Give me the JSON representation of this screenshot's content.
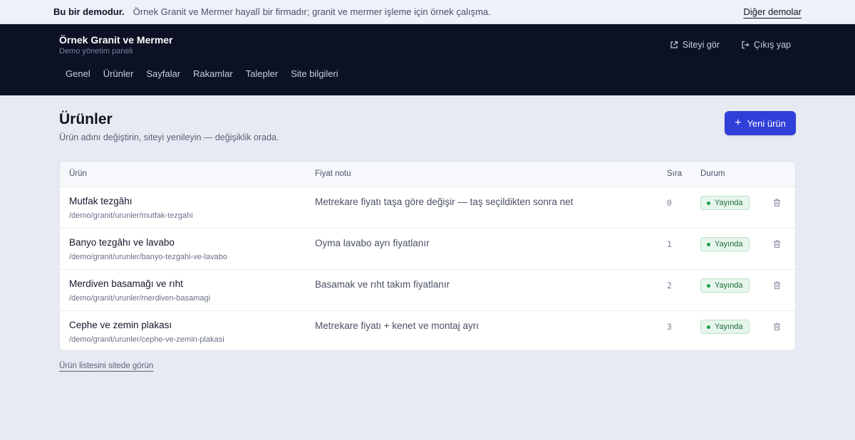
{
  "demo_bar": {
    "strong": "Bu bir demodur.",
    "desc": "Örnek Granit ve Mermer hayalî bir firmadır; granit ve mermer işleme için örnek çalışma.",
    "other_link": "Diğer demolar"
  },
  "header": {
    "brand": "Örnek Granit ve Mermer",
    "subtitle": "Demo yönetim paneli",
    "actions": [
      {
        "label": "Siteyi gör",
        "icon": "external-link-icon"
      },
      {
        "label": "Çıkış yap",
        "icon": "logout-icon"
      }
    ],
    "nav": [
      "Genel",
      "Ürünler",
      "Sayfalar",
      "Rakamlar",
      "Talepler",
      "Site bilgileri"
    ]
  },
  "page": {
    "title": "Ürünler",
    "subtitle": "Ürün adını değiştirin, siteyi yenileyin — değişiklik orada.",
    "new_button": "Yeni ürün"
  },
  "table": {
    "columns": {
      "product": "Ürün",
      "price_note": "Fiyat notu",
      "order": "Sıra",
      "status": "Durum"
    },
    "rows": [
      {
        "name": "Mutfak tezgâhı",
        "path": "/demo/granit/urunler/mutfak-tezgahi",
        "price_note": "Metrekare fiyatı taşa göre değişir — taş seçildikten sonra net",
        "order": "0",
        "status": "Yayında"
      },
      {
        "name": "Banyo tezgâhı ve lavabo",
        "path": "/demo/granit/urunler/banyo-tezgahi-ve-lavabo",
        "price_note": "Oyma lavabo ayrı fiyatlanır",
        "order": "1",
        "status": "Yayında"
      },
      {
        "name": "Merdiven basamağı ve rıht",
        "path": "/demo/granit/urunler/merdiven-basamagi",
        "price_note": "Basamak ve rıht takım fiyatlanır",
        "order": "2",
        "status": "Yayında"
      },
      {
        "name": "Cephe ve zemin plakası",
        "path": "/demo/granit/urunler/cephe-ve-zemin-plakasi",
        "price_note": "Metrekare fiyatı + kenet ve montaj ayrı",
        "order": "3",
        "status": "Yayında"
      }
    ]
  },
  "footer_link": "Ürün listesini sitede görün",
  "colors": {
    "accent": "#2f3fd8",
    "topbar": "#0d1125",
    "status_green": "#1d6b3a"
  }
}
